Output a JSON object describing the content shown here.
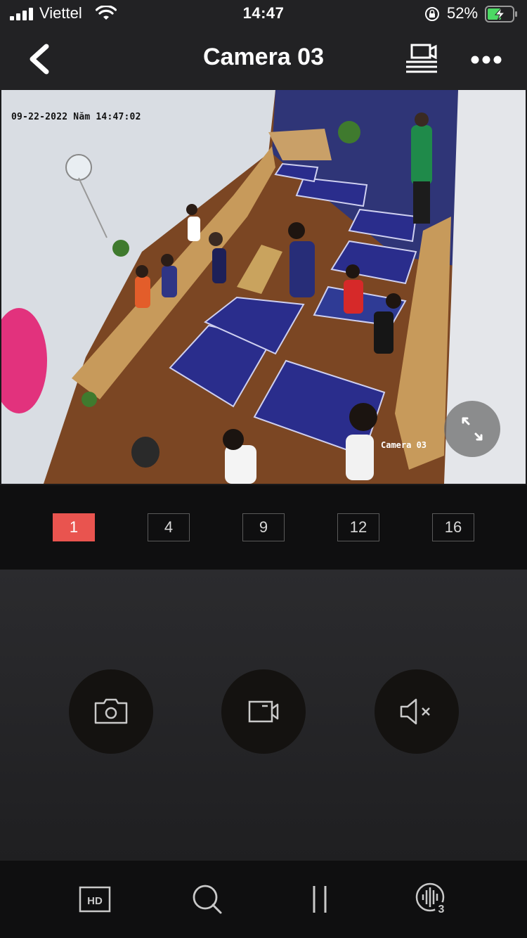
{
  "status_bar": {
    "carrier": "Viettel",
    "time": "14:47",
    "battery_percent": "52%"
  },
  "header": {
    "title": "Camera 03",
    "back_icon": "chevron-left-icon",
    "cast_icon": "cast-screen-icon",
    "more_icon": "more-dots-icon"
  },
  "video": {
    "timestamp": "09-22-2022 Năm 14:47:02",
    "camera_label": "Camera 03",
    "fullscreen_icon": "expand-arrows-icon"
  },
  "grid_options": {
    "opt1": "1",
    "opt4": "4",
    "opt9": "9",
    "opt12": "12",
    "opt16": "16",
    "selected": "1",
    "accent": "#e9544f"
  },
  "controls": {
    "snapshot_icon": "camera-icon",
    "record_icon": "video-record-icon",
    "mute_icon": "speaker-muted-icon"
  },
  "toolbar": {
    "hd_label": "HD",
    "zoom_icon": "search-icon",
    "pause_icon": "pause-icon",
    "channel_badge": "3"
  }
}
